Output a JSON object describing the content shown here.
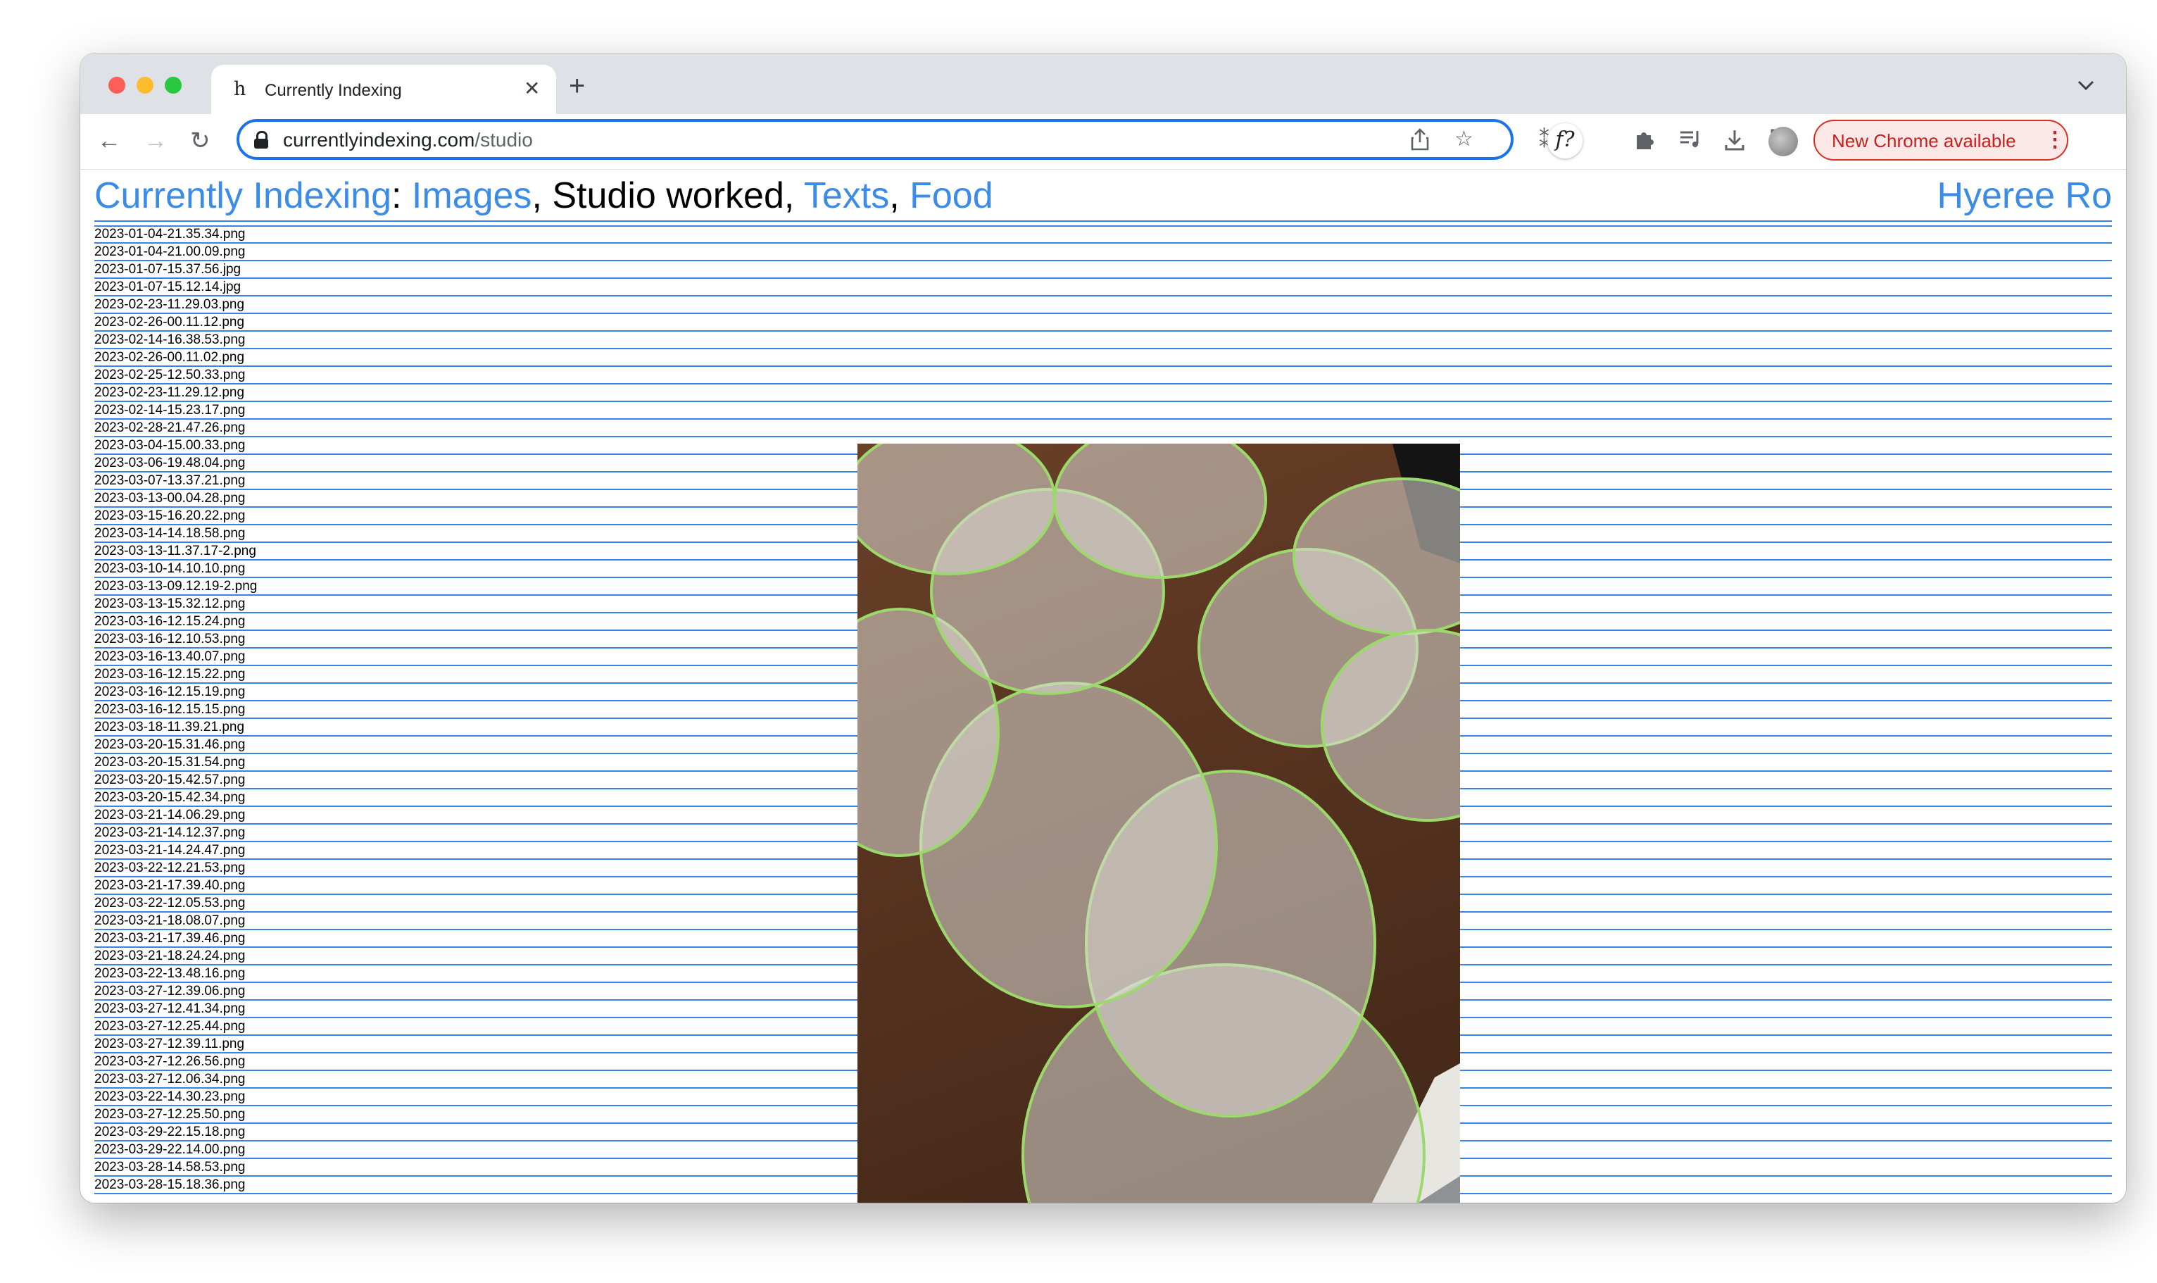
{
  "browser": {
    "tab_title": "Currently Indexing",
    "tab_favicon_letter": "h",
    "new_tab_symbol": "+",
    "url_domain": "currentlyindexing.com",
    "url_path": "/studio",
    "update_label": "New Chrome available",
    "extension_fx_label": "f?",
    "icons": [
      "back-icon",
      "forward-icon",
      "reload-icon",
      "lock-icon",
      "share-icon",
      "star-icon",
      "asterisk-extension-icon",
      "fx-extension-icon",
      "puzzle-icon",
      "media-icon",
      "download-icon",
      "sidepanel-icon",
      "avatar",
      "menu-icon"
    ]
  },
  "page": {
    "title_link": "Currently Indexing",
    "separator": ": ",
    "nav": {
      "images": "Images",
      "comma1": ", ",
      "studio": "Studio worked",
      "comma2": ", ",
      "texts": "Texts",
      "comma3": ", ",
      "food": "Food"
    },
    "author": "Hyeree Ro",
    "accent_color": "#3b8be8",
    "rule_color": "#3b82e6"
  },
  "files": [
    "2023-01-04-21.35.34.png",
    "2023-01-04-21.00.09.png",
    "2023-01-07-15.37.56.jpg",
    "2023-01-07-15.12.14.jpg",
    "2023-02-23-11.29.03.png",
    "2023-02-26-00.11.12.png",
    "2023-02-14-16.38.53.png",
    "2023-02-26-00.11.02.png",
    "2023-02-25-12.50.33.png",
    "2023-02-23-11.29.12.png",
    "2023-02-14-15.23.17.png",
    "2023-02-28-21.47.26.png",
    "2023-03-04-15.00.33.png",
    "2023-03-06-19.48.04.png",
    "2023-03-07-13.37.21.png",
    "2023-03-13-00.04.28.png",
    "2023-03-15-16.20.22.png",
    "2023-03-14-14.18.58.png",
    "2023-03-13-11.37.17-2.png",
    "2023-03-10-14.10.10.png",
    "2023-03-13-09.12.19-2.png",
    "2023-03-13-15.32.12.png",
    "2023-03-16-12.15.24.png",
    "2023-03-16-12.10.53.png",
    "2023-03-16-13.40.07.png",
    "2023-03-16-12.15.22.png",
    "2023-03-16-12.15.19.png",
    "2023-03-16-12.15.15.png",
    "2023-03-18-11.39.21.png",
    "2023-03-20-15.31.46.png",
    "2023-03-20-15.31.54.png",
    "2023-03-20-15.42.57.png",
    "2023-03-20-15.42.34.png",
    "2023-03-21-14.06.29.png",
    "2023-03-21-14.12.37.png",
    "2023-03-21-14.24.47.png",
    "2023-03-22-12.21.53.png",
    "2023-03-21-17.39.40.png",
    "2023-03-22-12.05.53.png",
    "2023-03-21-18.08.07.png",
    "2023-03-21-17.39.46.png",
    "2023-03-21-18.24.24.png",
    "2023-03-22-13.48.16.png",
    "2023-03-27-12.39.06.png",
    "2023-03-27-12.41.34.png",
    "2023-03-27-12.25.44.png",
    "2023-03-27-12.39.11.png",
    "2023-03-27-12.26.56.png",
    "2023-03-27-12.06.34.png",
    "2023-03-22-14.30.23.png",
    "2023-03-27-12.25.50.png",
    "2023-03-29-22.15.18.png",
    "2023-03-29-22.14.00.png",
    "2023-03-28-14.58.53.png",
    "2023-03-28-15.18.36.png"
  ]
}
